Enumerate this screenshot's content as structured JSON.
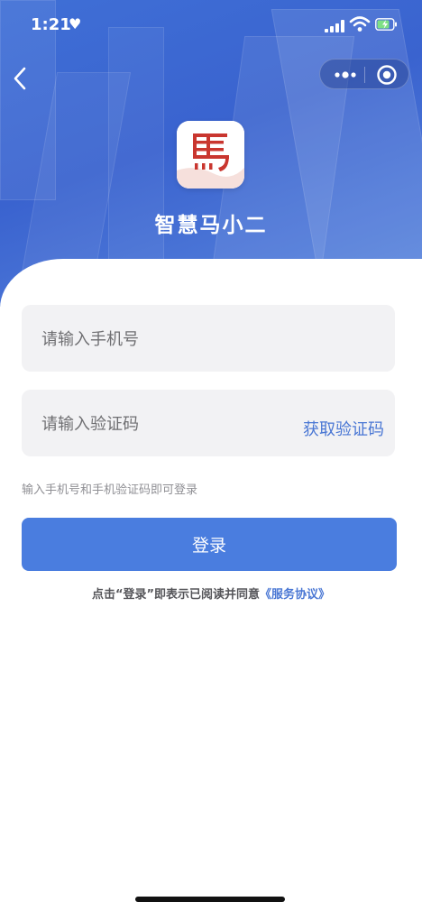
{
  "status_bar": {
    "time": "1:21",
    "heart": "♥"
  },
  "nav": {
    "back_icon": "chevron-left-icon",
    "more_icon": "more-dots-icon",
    "close_icon": "target-circle-icon"
  },
  "app": {
    "name": "智慧马小二",
    "logo_char": "馬"
  },
  "form": {
    "phone_placeholder": "请输入手机号",
    "code_placeholder": "请输入验证码",
    "get_code_label": "获取验证码",
    "hint": "输入手机号和手机验证码即可登录",
    "login_label": "登录"
  },
  "agreement": {
    "prefix": "点击“登录”即表示已阅读并同意",
    "link": "《服务协议》"
  },
  "colors": {
    "primary": "#4a7ddf",
    "hero_blue": "#3f6fd6",
    "link": "#4a77d4"
  }
}
